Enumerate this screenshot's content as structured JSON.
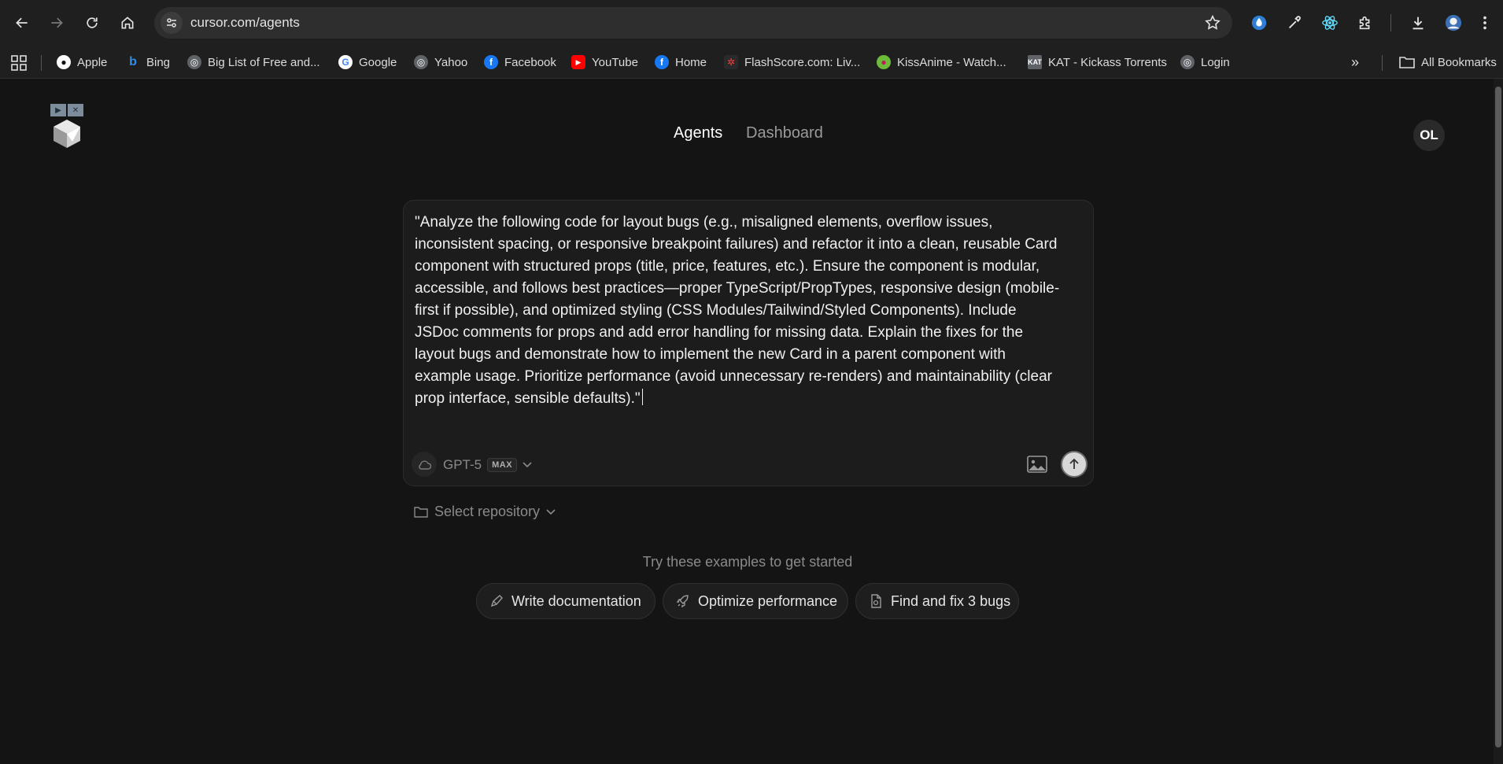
{
  "browser": {
    "url": "cursor.com/agents",
    "bookmarks": [
      {
        "label": "Apple",
        "icon": "apple-icon",
        "color": "#ffffff"
      },
      {
        "label": "Bing",
        "icon": "bing-icon",
        "color": "#2f8fe6"
      },
      {
        "label": "Big List of Free and...",
        "icon": "globe-icon",
        "color": "#9aa0a6"
      },
      {
        "label": "Google",
        "icon": "google-icon",
        "color": "#ffffff"
      },
      {
        "label": "Yahoo",
        "icon": "globe-icon",
        "color": "#9aa0a6"
      },
      {
        "label": "Facebook",
        "icon": "facebook-icon",
        "color": "#1877f2"
      },
      {
        "label": "YouTube",
        "icon": "youtube-icon",
        "color": "#ff0000"
      },
      {
        "label": "Home",
        "icon": "facebook-icon",
        "color": "#1877f2"
      },
      {
        "label": "FlashScore.com: Liv...",
        "icon": "flashscore-icon",
        "color": "#1a1a1a"
      },
      {
        "label": "KissAnime - Watch...",
        "icon": "kissanime-icon",
        "color": "#6dbb3a"
      },
      {
        "label": "KAT - Kickass Torrents",
        "icon": "kat-icon",
        "color": "#9aa0a6"
      },
      {
        "label": "Login",
        "icon": "globe-icon",
        "color": "#9aa0a6"
      }
    ],
    "all_bookmarks": "All Bookmarks"
  },
  "nav": {
    "agents": "Agents",
    "dashboard": "Dashboard",
    "avatar_initials": "OL"
  },
  "composer": {
    "prompt": "\"Analyze the following code for layout bugs (e.g., misaligned elements, overflow issues, inconsistent spacing, or responsive breakpoint failures) and refactor it into a clean, reusable Card component with structured props (title, price, features, etc.). Ensure the component is modular, accessible, and follows best practices—proper TypeScript/PropTypes, responsive design (mobile-first if possible), and optimized styling (CSS Modules/Tailwind/Styled Components). Include JSDoc comments for props and add error handling for missing data. Explain the fixes for the layout bugs and demonstrate how to implement the new Card in a parent component with example usage. Prioritize performance (avoid unnecessary re-renders) and maintainability (clear prop interface, sensible defaults).\"",
    "model": "GPT-5",
    "model_badge": "MAX"
  },
  "repository": {
    "label": "Select repository"
  },
  "examples": {
    "title": "Try these examples to get started",
    "chips": [
      {
        "label": "Write documentation",
        "icon": "pen-icon"
      },
      {
        "label": "Optimize performance",
        "icon": "rocket-icon"
      },
      {
        "label": "Find and fix 3 bugs",
        "icon": "file-bug-icon"
      }
    ]
  },
  "colors": {
    "background": "#141414",
    "composer": "#1c1c1c",
    "muted_text": "#8a8a8a",
    "active_nav": "#ffffff"
  }
}
